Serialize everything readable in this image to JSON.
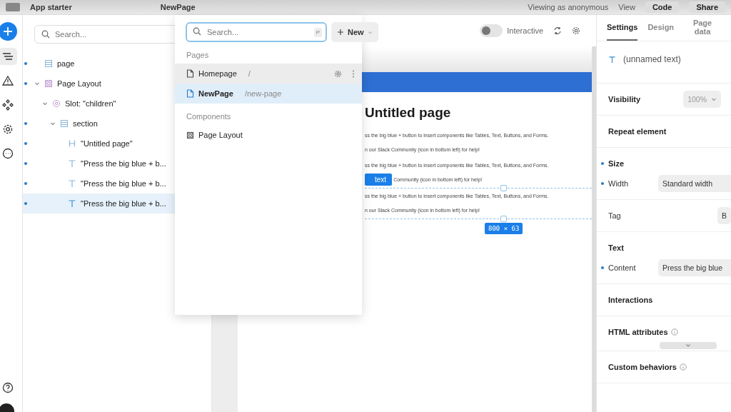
{
  "top_bar": {
    "app_name": "App starter",
    "page": "NewPage",
    "viewing_as": "Viewing as anonymous",
    "view": "View",
    "code": "Code",
    "share": "Share"
  },
  "rail": [
    {
      "kind": "add"
    },
    {
      "kind": "layers",
      "selected": true
    },
    {
      "kind": "warnings",
      "selected": false
    },
    {
      "kind": "components",
      "selected": false
    },
    {
      "kind": "settings",
      "selected": false
    },
    {
      "kind": "more",
      "selected": false
    }
  ],
  "rail_bottom": [
    {
      "kind": "help"
    }
  ],
  "tree": {
    "search_placeholder": "Search...",
    "items": [
      {
        "label": "page",
        "kind": "page",
        "modified": true,
        "selected": false
      },
      {
        "label": "Page Layout",
        "kind": "component",
        "modified": true,
        "selected": false,
        "expanded": true,
        "children": [
          {
            "label": "Slot: \"children\"",
            "kind": "slot",
            "modified": false,
            "selected": false,
            "expanded": true,
            "children": [
              {
                "label": "section",
                "kind": "section",
                "modified": true,
                "selected": false,
                "expanded": true,
                "children": [
                  {
                    "label": "\"Untitled page\"",
                    "kind": "heading",
                    "modified": true,
                    "selected": false
                  },
                  {
                    "label": "\"Press the big blue + b...",
                    "kind": "text",
                    "modified": true,
                    "selected": false
                  },
                  {
                    "label": "\"Press the big blue + b...",
                    "kind": "text",
                    "modified": true,
                    "selected": false
                  },
                  {
                    "label": "\"Press the big blue + b...",
                    "kind": "text",
                    "modified": true,
                    "selected": true
                  }
                ]
              }
            ]
          }
        ]
      }
    ]
  },
  "page_menu": {
    "search_placeholder": "Search...",
    "shortcut": "P",
    "new_label": "New",
    "sections": [
      {
        "title": "Pages",
        "items": [
          {
            "kind": "page",
            "name": "Homepage",
            "path": "/",
            "selected": false,
            "hovered": true
          },
          {
            "kind": "page",
            "name": "NewPage",
            "path": "/new-page",
            "selected": true,
            "hovered": false
          }
        ]
      },
      {
        "title": "Components",
        "items": [
          {
            "kind": "component",
            "name": "Page Layout",
            "selected": false,
            "hovered": false
          }
        ]
      }
    ]
  },
  "canvas": {
    "interactive_label": "Interactive",
    "interactive_on": false,
    "heading": "Untitled page",
    "blocks": [
      {
        "lines": [
          "ss the big blue + button to insert components like Tables, Text, Buttons, and Forms.",
          "n our Slack Community (icon in bottom left) for help!"
        ],
        "selected": false
      },
      {
        "lines": [
          "ss the big blue + button to insert components like Tables, Text, Buttons, and Forms.",
          "Community (icon in bottom left) for help!"
        ],
        "selected": false,
        "tag_badge": "text"
      },
      {
        "lines": [
          "ss the big blue + button to insert components like Tables, Text, Buttons, and Forms.",
          "n our Slack Community (icon in bottom left) for help!"
        ],
        "selected": true,
        "size_badge": "800 × 63"
      }
    ]
  },
  "inspector": {
    "tabs": [
      {
        "label": "Settings",
        "selected": true
      },
      {
        "label": "Design",
        "selected": false
      },
      {
        "label": "Page data",
        "selected": false
      }
    ],
    "element_name": "(unnamed text)",
    "groups": [
      {
        "rows": [
          {
            "kind": "select",
            "label": "Visibility",
            "value": "100%",
            "modified": false,
            "chevron": true
          }
        ]
      },
      {
        "rows": [
          {
            "kind": "heading",
            "label": "Repeat element",
            "modified": false
          }
        ]
      },
      {
        "rows": [
          {
            "kind": "heading",
            "label": "Size",
            "modified": true
          },
          {
            "kind": "field",
            "label": "Width",
            "value": "Standard width",
            "modified": true
          }
        ]
      },
      {
        "rows": [
          {
            "kind": "select",
            "label": "Tag",
            "value": "B",
            "modified": false,
            "chevron": false
          }
        ]
      },
      {
        "rows": [
          {
            "kind": "heading",
            "label": "Text",
            "modified": false
          },
          {
            "kind": "field",
            "label": "Content",
            "value": "Press the big blue",
            "modified": true
          }
        ]
      },
      {
        "rows": [
          {
            "kind": "heading",
            "label": "Interactions",
            "modified": false
          }
        ]
      },
      {
        "rows": [
          {
            "kind": "heading",
            "label": "HTML attributes",
            "modified": false,
            "info": true
          },
          {
            "kind": "expander"
          }
        ]
      },
      {
        "rows": [
          {
            "kind": "heading",
            "label": "Custom behaviors",
            "modified": false,
            "info": true
          }
        ]
      }
    ]
  }
}
